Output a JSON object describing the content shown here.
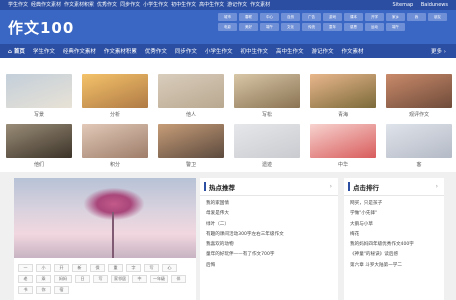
{
  "topbar": {
    "links": [
      "学生作文",
      "经典作文素材",
      "作文素材积累",
      "优秀作文",
      "同步作文",
      "小学生作文",
      "初中生作文",
      "高中生作文",
      "游记作文",
      "作文素材"
    ],
    "right": [
      "Sitemap",
      "Baidunews"
    ]
  },
  "header": {
    "logo": "作文100",
    "tags": [
      "城市",
      "春联",
      "中心",
      "自然",
      "广告",
      "游戏",
      "课本",
      "开学",
      "家乡",
      "我",
      "朋友",
      "电影",
      "美好",
      "端午",
      "文化",
      "传统",
      "童年",
      "感恩",
      "运动",
      "端午"
    ]
  },
  "nav": {
    "items": [
      "⌂ 首页",
      "学生作文",
      "经典作文素材",
      "作文素材积累",
      "优秀作文",
      "同步作文",
      "小学生作文",
      "初中生作文",
      "高中生作文",
      "游记作文",
      "作文素材"
    ],
    "more": "更多 ›"
  },
  "cards": [
    {
      "label": "写景",
      "colors": [
        "#c3cfda",
        "#e8e2d6"
      ]
    },
    {
      "label": "分析",
      "colors": [
        "#f4c36a",
        "#b07a45"
      ]
    },
    {
      "label": "他人",
      "colors": [
        "#d9cdbc",
        "#b9a890"
      ]
    },
    {
      "label": "写松",
      "colors": [
        "#d8c7a8",
        "#8a7352"
      ]
    },
    {
      "label": "青海",
      "colors": [
        "#e9b78c",
        "#7b6a3a"
      ]
    },
    {
      "label": "观评作文",
      "colors": [
        "#c98a6a",
        "#6f4b3a"
      ]
    },
    {
      "label": "他们",
      "colors": [
        "#9a8d78",
        "#3c3328"
      ]
    },
    {
      "label": "积分",
      "colors": [
        "#e2c9b8",
        "#9e7d6a"
      ]
    },
    {
      "label": "警卫",
      "colors": [
        "#c79d78",
        "#5c4a3e"
      ]
    },
    {
      "label": "遗迹",
      "colors": [
        "#e6e7ea",
        "#c9cbd0"
      ]
    },
    {
      "label": "中华",
      "colors": [
        "#f7d3cf",
        "#d85c5c"
      ]
    },
    {
      "label": "客",
      "colors": [
        "#dfe3ea",
        "#b4bac6"
      ]
    }
  ],
  "banner": {
    "chips": [
      "一",
      "小",
      "开",
      "新",
      "保",
      "重",
      "字",
      "写",
      "心",
      "老",
      "乘",
      "妈妈",
      "日",
      "写",
      "家邻居",
      "中",
      "一年级",
      "伴",
      "书",
      "你",
      "宿"
    ]
  },
  "hot": {
    "title": "热点推荐",
    "items": [
      "我的家国情",
      "母爱是伟大",
      "绿叶（二）",
      "有趣的课间活动300字左右三年级作文",
      "我喜欢的动物",
      "童年的好玩伴——有了作文700字",
      "后悔"
    ]
  },
  "rank": {
    "title": "点击排行",
    "items": [
      "网买，只是孩子",
      "学做\"小先锋\"",
      "大鹅与小草",
      "梅花",
      "我的妈妈四年级优秀作文400字",
      "《神童\"的秘诀》读后感",
      "第六章 斗罗大陆第一学二"
    ]
  }
}
